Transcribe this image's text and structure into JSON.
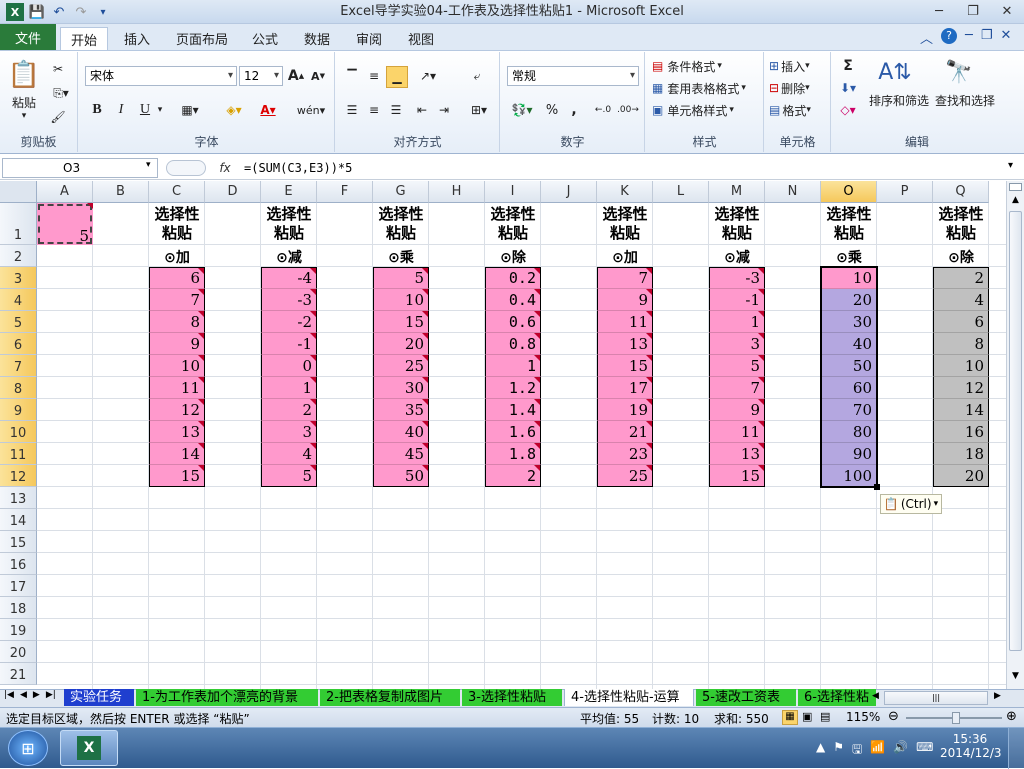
{
  "window": {
    "title": "Excel导学实验04-工作表及选择性粘贴1  -  Microsoft Excel"
  },
  "ribbon": {
    "file_tab": "文件",
    "tabs": [
      "开始",
      "插入",
      "页面布局",
      "公式",
      "数据",
      "审阅",
      "视图"
    ],
    "active_tab": "开始",
    "groups": {
      "clipboard": {
        "label": "剪贴板",
        "paste": "粘贴"
      },
      "font": {
        "label": "字体",
        "font_name": "宋体",
        "font_size": "12",
        "bold": "B",
        "italic": "I",
        "underline": "U"
      },
      "alignment": {
        "label": "对齐方式"
      },
      "number": {
        "label": "数字",
        "format": "常规",
        "percent": "%",
        "comma": ","
      },
      "styles": {
        "label": "样式",
        "conditional": "条件格式",
        "table": "套用表格格式",
        "cell_styles": "单元格样式"
      },
      "cells": {
        "label": "单元格",
        "insert": "插入",
        "delete": "删除",
        "format": "格式"
      },
      "editing": {
        "label": "编辑",
        "sort": "排序和筛选",
        "find": "查找和选择",
        "sum": "Σ"
      }
    }
  },
  "formula_bar": {
    "name_box": "O3",
    "fx": "fx",
    "formula": "=(SUM(C3,E3))*5"
  },
  "grid": {
    "columns": [
      "A",
      "B",
      "C",
      "D",
      "E",
      "F",
      "G",
      "H",
      "I",
      "J",
      "K",
      "L",
      "M",
      "N",
      "O",
      "P",
      "Q"
    ],
    "selected_column": "O",
    "rows": [
      "1",
      "2",
      "3",
      "4",
      "5",
      "6",
      "7",
      "8",
      "9",
      "10",
      "11",
      "12",
      "13",
      "14",
      "15",
      "16",
      "17",
      "18",
      "19",
      "20",
      "21"
    ],
    "selected_rows": [
      "3",
      "4",
      "5",
      "6",
      "7",
      "8",
      "9",
      "10",
      "11",
      "12"
    ],
    "a1_value": "5",
    "headers": [
      {
        "col": "C",
        "title1": "选择性",
        "title2": "粘贴",
        "option": "⊙加"
      },
      {
        "col": "E",
        "title1": "选择性",
        "title2": "粘贴",
        "option": "⊙减"
      },
      {
        "col": "G",
        "title1": "选择性",
        "title2": "粘贴",
        "option": "⊙乘"
      },
      {
        "col": "I",
        "title1": "选择性",
        "title2": "粘贴",
        "option": "⊙除"
      },
      {
        "col": "K",
        "title1": "选择性",
        "title2": "粘贴",
        "option": "⊙加"
      },
      {
        "col": "M",
        "title1": "选择性",
        "title2": "粘贴",
        "option": "⊙减"
      },
      {
        "col": "O",
        "title1": "选择性",
        "title2": "粘贴",
        "option": "⊙乘"
      },
      {
        "col": "Q",
        "title1": "选择性",
        "title2": "粘贴",
        "option": "⊙除"
      }
    ],
    "data_columns": {
      "C": [
        "6",
        "7",
        "8",
        "9",
        "10",
        "11",
        "12",
        "13",
        "14",
        "15"
      ],
      "E": [
        "-4",
        "-3",
        "-2",
        "-1",
        "0",
        "1",
        "2",
        "3",
        "4",
        "5"
      ],
      "G": [
        "5",
        "10",
        "15",
        "20",
        "25",
        "30",
        "35",
        "40",
        "45",
        "50"
      ],
      "I": [
        "0.2",
        "0.4",
        "0.6",
        "0.8",
        "1",
        "1.2",
        "1.4",
        "1.6",
        "1.8",
        "2"
      ],
      "K": [
        "7",
        "9",
        "11",
        "13",
        "15",
        "17",
        "19",
        "21",
        "23",
        "25"
      ],
      "M": [
        "-3",
        "-1",
        "1",
        "3",
        "5",
        "7",
        "9",
        "11",
        "13",
        "15"
      ],
      "O": [
        "10",
        "20",
        "30",
        "40",
        "50",
        "60",
        "70",
        "80",
        "90",
        "100"
      ],
      "Q": [
        "2",
        "4",
        "6",
        "8",
        "10",
        "12",
        "14",
        "16",
        "18",
        "20"
      ]
    },
    "paste_options": "(Ctrl)"
  },
  "sheet_tabs": [
    "实验任务",
    "1-为工作表加个漂亮的背景",
    "2-把表格复制成图片",
    "3-选择性粘贴",
    "4-选择性粘贴-运算",
    "5-速改工资表",
    "6-选择性粘"
  ],
  "active_sheet": "4-选择性粘贴-运算",
  "status": {
    "message": "选定目标区域，然后按 ENTER 或选择 “粘贴”",
    "average": "平均值: 55",
    "count": "计数: 10",
    "sum": "求和: 550",
    "zoom": "115%"
  },
  "taskbar": {
    "time": "15:36",
    "date": "2014/12/3"
  },
  "colors": {
    "pink": "#ff99cc",
    "violet": "#b4a7e0",
    "gray": "#c0c0c0",
    "file_green": "#2a7b3a",
    "tab_green": "#33cc33"
  }
}
